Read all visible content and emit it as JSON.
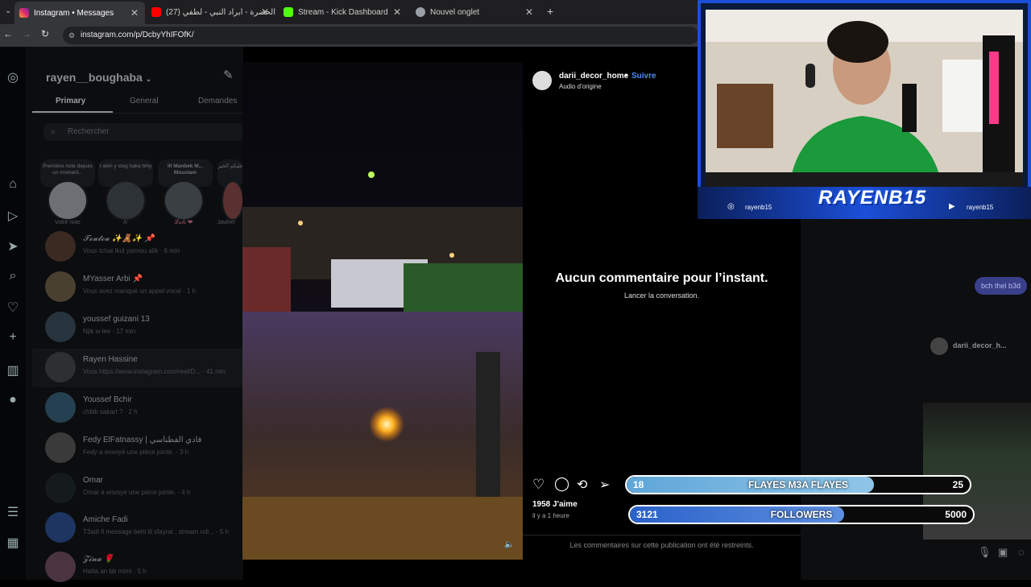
{
  "browser": {
    "tabs": [
      {
        "title": "Instagram • Messages",
        "icon_color": "#e1306c",
        "active": true
      },
      {
        "title": "(27) الحضرة - ابراد النبي - لطفي",
        "icon_color": "#ff0000",
        "active": false
      },
      {
        "title": "Stream - Kick Dashboard",
        "icon_color": "#53fc18",
        "active": false
      },
      {
        "title": "Nouvel onglet",
        "icon_color": "#9aa0a6",
        "active": false
      }
    ],
    "new_tab": "+",
    "url": "instagram.com/p/DcbyYhIFOfK/"
  },
  "dm": {
    "username": "rayen__boughaba",
    "tabs": [
      "Primary",
      "General",
      "Demandes"
    ],
    "search_placeholder": "Rechercher",
    "notes": [
      "Première note depuis un moment...",
      "t aleh y steg haka bihy",
      "lll Manbek M... Mouslam",
      "علیکم الخير"
    ],
    "stories": [
      "Votre note",
      "A'",
      "𝓛𝓪𝓵𝓲 ❤",
      "Jawher"
    ],
    "conversations": [
      {
        "name": "𝓣𝓸𝓾𝓽𝓸𝓾 ✨🧸✨ 📌",
        "preview": "Vous tchat lkol ysimou alik · 6 min"
      },
      {
        "name": "MYasser Arbi 📌",
        "preview": "Vous avez manqué un appel vocal · 1 h"
      },
      {
        "name": "youssef guizani 13",
        "preview": "Njik w lee · 17 min"
      },
      {
        "name": "Rayen Hassine",
        "preview": "Vous https://www.instagram.com/reel/D... · 41 min"
      },
      {
        "name": "Youssef Bchir",
        "preview": "chbik sakart ? · 2 h"
      },
      {
        "name": "Fedy ElFatnassy | فادي الفطناسي",
        "preview": "Fedy a envoyé une pièce jointe. · 3 h"
      },
      {
        "name": "Omar",
        "preview": "Omar a envoyé une pièce jointe. · 4 h"
      },
      {
        "name": "Amiche Fadi",
        "preview": "T3adi fi message behi lil sfayrat , stream ndi... · 5 h"
      },
      {
        "name": "𝓩𝓲𝓷𝓪 🌹",
        "preview": "Hatta an bb mimi · 5 h"
      }
    ]
  },
  "post": {
    "author": "darii_decor_home",
    "follow": "Suivre",
    "audio": "Audio d'origine",
    "no_comments": "Aucun commentaire pour l’instant.",
    "start_conversation": "Lancer la conversation.",
    "likes": "1958 J'aime",
    "time": "il y a 1 heure",
    "restricted": "Les commentaires sur cette publication ont été restreints."
  },
  "chat": {
    "bubble": "bch thel b3d",
    "shared_author": "darii_decor_h..."
  },
  "overlay": {
    "streamer_name": "RAYENB15",
    "instagram_handle": "rayenb15",
    "youtube_handle": "rayenb15",
    "frame_color": "#1b4fd8"
  },
  "goals": [
    {
      "label": "FLAYES M3A FLAYES",
      "current": "18",
      "max": "25",
      "progress": 0.72
    },
    {
      "label": "FOLLOWERS",
      "current": "3121",
      "max": "5000",
      "progress": 0.624
    }
  ]
}
